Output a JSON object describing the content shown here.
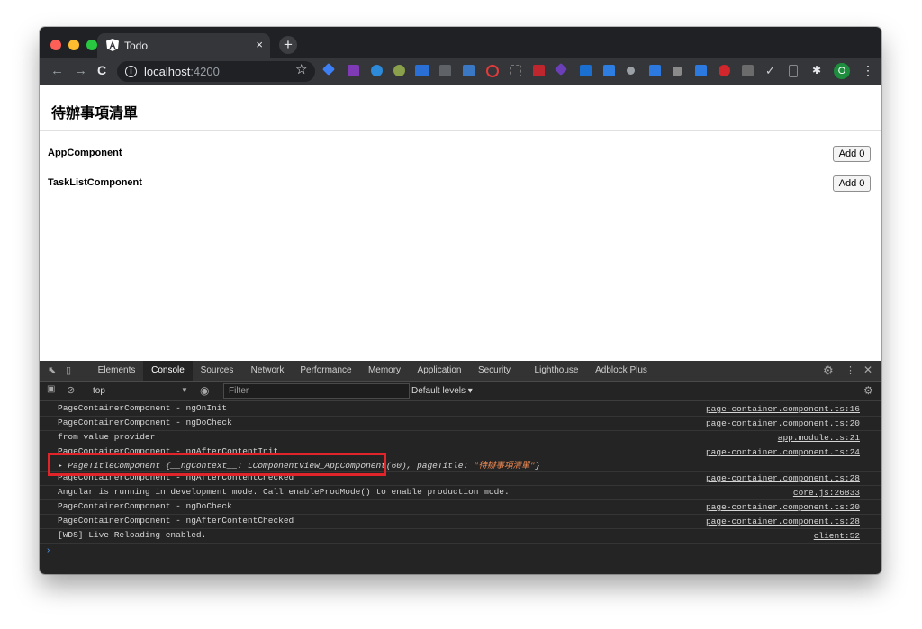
{
  "browser": {
    "tab_title": "Todo",
    "tab_close": "×",
    "new_tab": "+",
    "url_host": "localhost",
    "url_port": ":4200",
    "nav_back": "←",
    "nav_forward": "→",
    "nav_reload": "C",
    "star": "☆",
    "avatar_letter": "O",
    "menu": "⋮",
    "info": "i"
  },
  "page": {
    "title": "待辦事項清單",
    "components": [
      {
        "label": "AppComponent",
        "button": "Add 0"
      },
      {
        "label": "TaskListComponent",
        "button": "Add 0"
      }
    ]
  },
  "devtools": {
    "tabs": [
      "Elements",
      "Console",
      "Sources",
      "Network",
      "Performance",
      "Memory",
      "Application",
      "Security",
      "Lighthouse",
      "Adblock Plus"
    ],
    "active_tab": "Console",
    "context": "top",
    "filter_placeholder": "Filter",
    "levels": "Default levels ▾",
    "lines": [
      {
        "msg": "PageContainerComponent - ngOnInit",
        "src": "page-container.component.ts:16"
      },
      {
        "msg": "PageContainerComponent - ngDoCheck",
        "src": "page-container.component.ts:20"
      },
      {
        "msg": "from value provider",
        "src": "app.module.ts:21"
      },
      {
        "msg": "PageContainerComponent - ngAfterContentInit",
        "src": "page-container.component.ts:24",
        "sub_prefix": "▸ PageTitleComponent {__ngContext__: LComponentView_AppComponent(60), pageTitle: ",
        "sub_string": "\"待辦事項清單\"",
        "sub_suffix": "}"
      },
      {
        "msg": "PageContainerComponent - ngAfterContentChecked",
        "src": "page-container.component.ts:28"
      },
      {
        "msg": "Angular is running in development mode. Call enableProdMode() to enable production mode.",
        "src": "core.js:26833"
      },
      {
        "msg": "PageContainerComponent - ngDoCheck",
        "src": "page-container.component.ts:20"
      },
      {
        "msg": "PageContainerComponent - ngAfterContentChecked",
        "src": "page-container.component.ts:28"
      },
      {
        "msg": "[WDS] Live Reloading enabled.",
        "src": "client:52"
      }
    ],
    "prompt": "›"
  },
  "colors": {
    "highlight_box": "#e0242a",
    "chrome_dark": "#202124",
    "devtools_bg": "#242424"
  }
}
